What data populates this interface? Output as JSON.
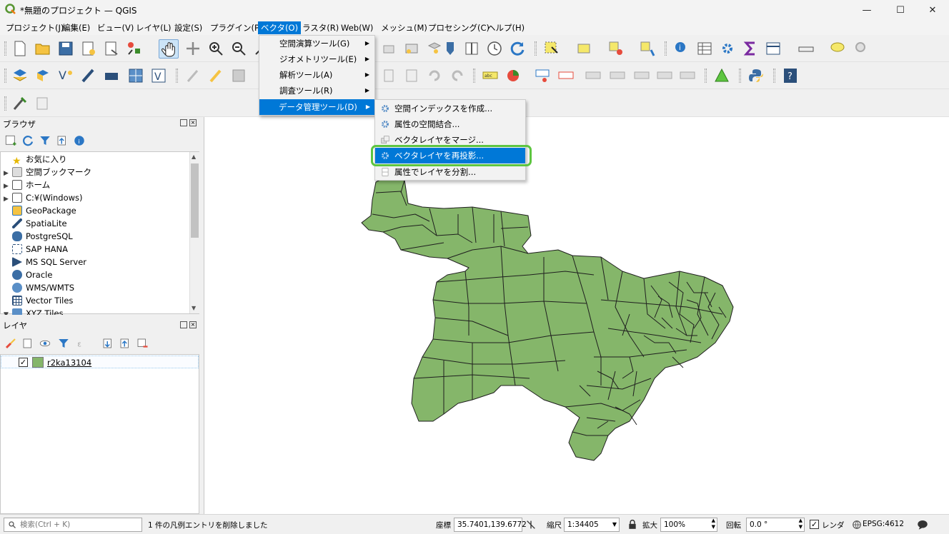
{
  "window": {
    "title": "*無題のプロジェクト — QGIS",
    "minimize": "—",
    "maximize": "☐",
    "close": "✕"
  },
  "menubar": [
    "プロジェクト(J)",
    "編集(E)",
    "ビュー(V)",
    "レイヤ(L)",
    "設定(S)",
    "プラグイン(P)",
    "ベクタ(O)",
    "ラスタ(R)",
    "Web(W)",
    "メッシュ(M)",
    "プロセシング(C)",
    "ヘルプ(H)"
  ],
  "vector_menu": {
    "items": [
      "空間演算ツール(G)",
      "ジオメトリツール(E)",
      "解析ツール(A)",
      "調査ツール(R)",
      "データ管理ツール(D)"
    ]
  },
  "data_mgmt_submenu": {
    "items": [
      "空間インデックスを作成...",
      "属性の空間結合...",
      "ベクタレイヤをマージ...",
      "ベクタレイヤを再投影...",
      "属性でレイヤを分割..."
    ],
    "highlighted_index": 3,
    "highlight_color": "#5dc540"
  },
  "browser": {
    "title": "ブラウザ",
    "items": [
      "お気に入り",
      "空間ブックマーク",
      "ホーム",
      "C:¥(Windows)",
      "GeoPackage",
      "SpatiaLite",
      "PostgreSQL",
      "SAP HANA",
      "MS SQL Server",
      "Oracle",
      "WMS/WMTS",
      "Vector Tiles",
      "XYZ Tiles"
    ]
  },
  "layers": {
    "title": "レイヤ",
    "items": [
      {
        "name": "r2ka13104",
        "checked": true,
        "color": "#85b66a"
      }
    ]
  },
  "map": {
    "fill_color": "#85b66a",
    "stroke_color": "#1e1e1e"
  },
  "statusbar": {
    "search_placeholder": "検索(Ctrl + K)",
    "message": "1 件の凡例エントリを削除しました",
    "coord_label": "座標",
    "coord_value": "35.7401,139.6772",
    "scale_label": "縮尺",
    "scale_value": "1:34405",
    "magnifier_label": "拡大",
    "magnifier_value": "100%",
    "rotation_label": "回転",
    "rotation_value": "0.0 °",
    "render_label": "レンダ",
    "crs": "EPSG:4612"
  }
}
